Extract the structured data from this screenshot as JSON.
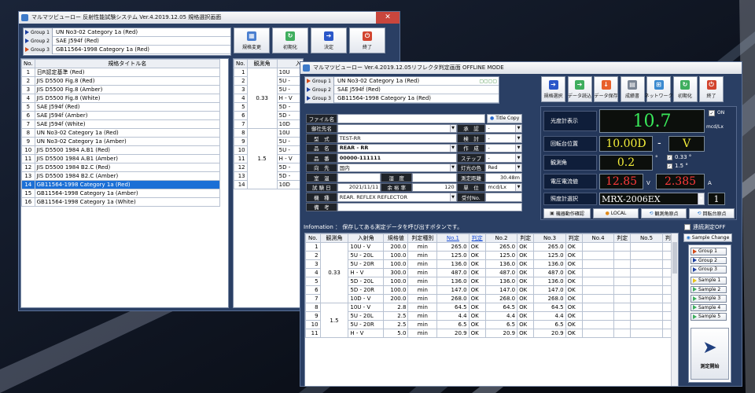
{
  "win1": {
    "title": "マルマツビューロー 反射性能試験システム Ver.4.2019.12.05 規格選択画面",
    "groups": [
      {
        "label": "Group 1",
        "value": "UN No3-02 Category 1a  (Red)"
      },
      {
        "label": "Group 2",
        "value": "SAE J594f  (Red)"
      },
      {
        "label": "Group 3",
        "value": "GB11564-1998 Category 1a  (Red)"
      }
    ],
    "buttons": [
      "規格変更",
      "初期化",
      "決定",
      "終了"
    ],
    "list_headers": {
      "no": "No.",
      "title": "規格タイトル名"
    },
    "list": [
      {
        "no": "1",
        "name": "日R認定基準 (Red)"
      },
      {
        "no": "2",
        "name": "JIS D5500 Fig.8  (Red)"
      },
      {
        "no": "3",
        "name": "JIS D5500 Fig.8  (Amber)"
      },
      {
        "no": "4",
        "name": "JIS D5500 Fig.8  (White)"
      },
      {
        "no": "5",
        "name": "SAE J594f  (Red)"
      },
      {
        "no": "6",
        "name": "SAE J594f  (Amber)"
      },
      {
        "no": "7",
        "name": "SAE J594f  (White)"
      },
      {
        "no": "8",
        "name": "UN No3-02 Category 1a  (Red)"
      },
      {
        "no": "9",
        "name": "UN No3-02 Category 1a  (Amber)"
      },
      {
        "no": "10",
        "name": "JIS D5500 1984 A.B1  (Red)"
      },
      {
        "no": "11",
        "name": "JIS D5500 1984 A.B1  (Amber)"
      },
      {
        "no": "12",
        "name": "JIS D5500 1984 B2.C  (Red)"
      },
      {
        "no": "13",
        "name": "JIS D5500 1984 B2.C  (Amber)"
      },
      {
        "no": "14",
        "name": "GB11564-1998 Category 1a  (Red)"
      },
      {
        "no": "15",
        "name": "GB11564-1998 Category 1a  (Amber)"
      },
      {
        "no": "16",
        "name": "GB11564-1998 Category 1a  (White)"
      }
    ],
    "angle_headers": {
      "no": "No.",
      "obs": "観測角",
      "inc": "入"
    },
    "angle_rows": [
      {
        "no": "1",
        "inc": "10U"
      },
      {
        "no": "2",
        "inc": "5U -"
      },
      {
        "no": "3",
        "inc": "5U -"
      },
      {
        "no": "4",
        "inc": "H - V"
      },
      {
        "no": "5",
        "inc": "5D -"
      },
      {
        "no": "6",
        "inc": "5D -"
      },
      {
        "no": "7",
        "inc": "10D"
      },
      {
        "no": "8",
        "inc": "10U"
      },
      {
        "no": "9",
        "inc": "5U -"
      },
      {
        "no": "10",
        "inc": "5U -"
      },
      {
        "no": "11",
        "inc": "H - V"
      },
      {
        "no": "12",
        "inc": "5D -"
      },
      {
        "no": "13",
        "inc": "5D -"
      },
      {
        "no": "14",
        "inc": "10D"
      }
    ],
    "obs_a": "0.33",
    "obs_b": "1.5"
  },
  "win2": {
    "title": "マルマツビューロー Ver.4.2019.12.05リフレクタ判定画面 OFFLINE MODE",
    "groups": [
      {
        "label": "Group 1",
        "value": "UN No3-02 Category 1a  (Red)"
      },
      {
        "label": "Group 2",
        "value": "SAE J594f  (Red)"
      },
      {
        "label": "Group 3",
        "value": "GB11564-1998 Category 1a  (Red)"
      }
    ],
    "toolbar": [
      "規格選択",
      "データ読込",
      "データ保存",
      "成績書",
      "ネットワーク",
      "初期化",
      "終了"
    ],
    "form": {
      "file": "ファイル名",
      "title_copy": "Title Copy",
      "customer": "御社先名",
      "approve": "承　認",
      "model": "型　式",
      "model_val": "TEST-RR",
      "inspect": "検　討",
      "product": "品　名",
      "product_val": "REAR - RR",
      "create": "作　成",
      "part": "品　番",
      "part_val": "00000-111111",
      "step": "ステップ",
      "dest": "向　先",
      "dest_val": "国内",
      "lamp": "灯光の色",
      "lamp_val": "Red",
      "room": "室　温",
      "humid": "湿　度",
      "dist": "測定距離",
      "dist_val": "30.48m",
      "test_date": "試 験 日",
      "test_date_val": "2021/11/11",
      "margin": "余 裕 率",
      "margin_val": "120",
      "unit": "単　位",
      "unit_val": "mcd/Lx",
      "device": "機　種",
      "device_val": "REAR. REFLEX REFLECTOR",
      "receipt": "受付No.",
      "note": "備　考",
      "dash": "-"
    },
    "meter": {
      "photo_label": "光度計表示",
      "photo_val": "10.7",
      "photo_unit": "mcd/Lx",
      "on_label": "ON",
      "rot_label": "回転台位置",
      "rot_val": "10.00D",
      "rot_sep": "-",
      "rot_v": "V",
      "obs_label": "観測角",
      "obs_val": "0.2",
      "obs_opt1": "0.33 °",
      "obs_opt2": "1.5 °",
      "volt_label": "電圧電流値",
      "volt_val": "12.85",
      "volt_unit": "V",
      "amp_val": "2.385",
      "amp_unit": "A",
      "meter_label": "照度計選択",
      "meter_val": "MRX-2006EX",
      "meter_num": "1",
      "btn_check": "機器動作確認",
      "btn_local": "LOCAL",
      "btn_origin": "観測角原点",
      "btn_rot": "回転台原点"
    },
    "info": "Infomation ： 保存してある測定データを呼び出すボタンです。",
    "continuous": "連続測定OFF",
    "sample_change": "Sample Change",
    "side_groups": [
      "Group 1",
      "Group 2",
      "Group 3"
    ],
    "samples": [
      "Sample 1",
      "Sample 2",
      "Sample 3",
      "Sample 4",
      "Sample 5"
    ],
    "start": "測定開始",
    "headers": [
      "No.",
      "観測角",
      "入射角",
      "規格値",
      "判定種別",
      "No.1",
      "判定",
      "No.2",
      "判定",
      "No.3",
      "判定",
      "No.4",
      "判定",
      "No.5",
      "判定"
    ],
    "obs_a": "0.33",
    "obs_b": "1.5",
    "rows": [
      {
        "no": "1",
        "inc": "10U - V",
        "std": "200.0",
        "kind": "min",
        "v1": "265.0",
        "j1": "OK",
        "v2": "265.0",
        "j2": "OK",
        "v3": "265.0",
        "j3": "OK"
      },
      {
        "no": "2",
        "inc": "5U - 20L",
        "std": "100.0",
        "kind": "min",
        "v1": "125.0",
        "j1": "OK",
        "v2": "125.0",
        "j2": "OK",
        "v3": "125.0",
        "j3": "OK"
      },
      {
        "no": "3",
        "inc": "5U - 20R",
        "std": "100.0",
        "kind": "min",
        "v1": "136.0",
        "j1": "OK",
        "v2": "136.0",
        "j2": "OK",
        "v3": "136.0",
        "j3": "OK"
      },
      {
        "no": "4",
        "inc": "H - V",
        "std": "300.0",
        "kind": "min",
        "v1": "487.0",
        "j1": "OK",
        "v2": "487.0",
        "j2": "OK",
        "v3": "487.0",
        "j3": "OK"
      },
      {
        "no": "5",
        "inc": "5D - 20L",
        "std": "100.0",
        "kind": "min",
        "v1": "136.0",
        "j1": "OK",
        "v2": "136.0",
        "j2": "OK",
        "v3": "136.0",
        "j3": "OK"
      },
      {
        "no": "6",
        "inc": "5D - 20R",
        "std": "100.0",
        "kind": "min",
        "v1": "147.0",
        "j1": "OK",
        "v2": "147.0",
        "j2": "OK",
        "v3": "147.0",
        "j3": "OK"
      },
      {
        "no": "7",
        "inc": "10D - V",
        "std": "200.0",
        "kind": "min",
        "v1": "268.0",
        "j1": "OK",
        "v2": "268.0",
        "j2": "OK",
        "v3": "268.0",
        "j3": "OK"
      },
      {
        "no": "8",
        "inc": "10U - V",
        "std": "2.8",
        "kind": "min",
        "v1": "64.5",
        "j1": "OK",
        "v2": "64.5",
        "j2": "OK",
        "v3": "64.5",
        "j3": "OK"
      },
      {
        "no": "9",
        "inc": "5U - 20L",
        "std": "2.5",
        "kind": "min",
        "v1": "4.4",
        "j1": "OK",
        "v2": "4.4",
        "j2": "OK",
        "v3": "4.4",
        "j3": "OK"
      },
      {
        "no": "10",
        "inc": "5U - 20R",
        "std": "2.5",
        "kind": "min",
        "v1": "6.5",
        "j1": "OK",
        "v2": "6.5",
        "j2": "OK",
        "v3": "6.5",
        "j3": "OK"
      },
      {
        "no": "11",
        "inc": "H - V",
        "std": "5.0",
        "kind": "min",
        "v1": "20.9",
        "j1": "OK",
        "v2": "20.9",
        "j2": "OK",
        "v3": "20.9",
        "j3": "OK"
      }
    ],
    "colors": {
      "green_lcd": "#39e85a",
      "yellow_lcd": "#f5ef3a",
      "red_lcd": "#ff3a3a",
      "select_blue": "#1b6fd6"
    }
  }
}
